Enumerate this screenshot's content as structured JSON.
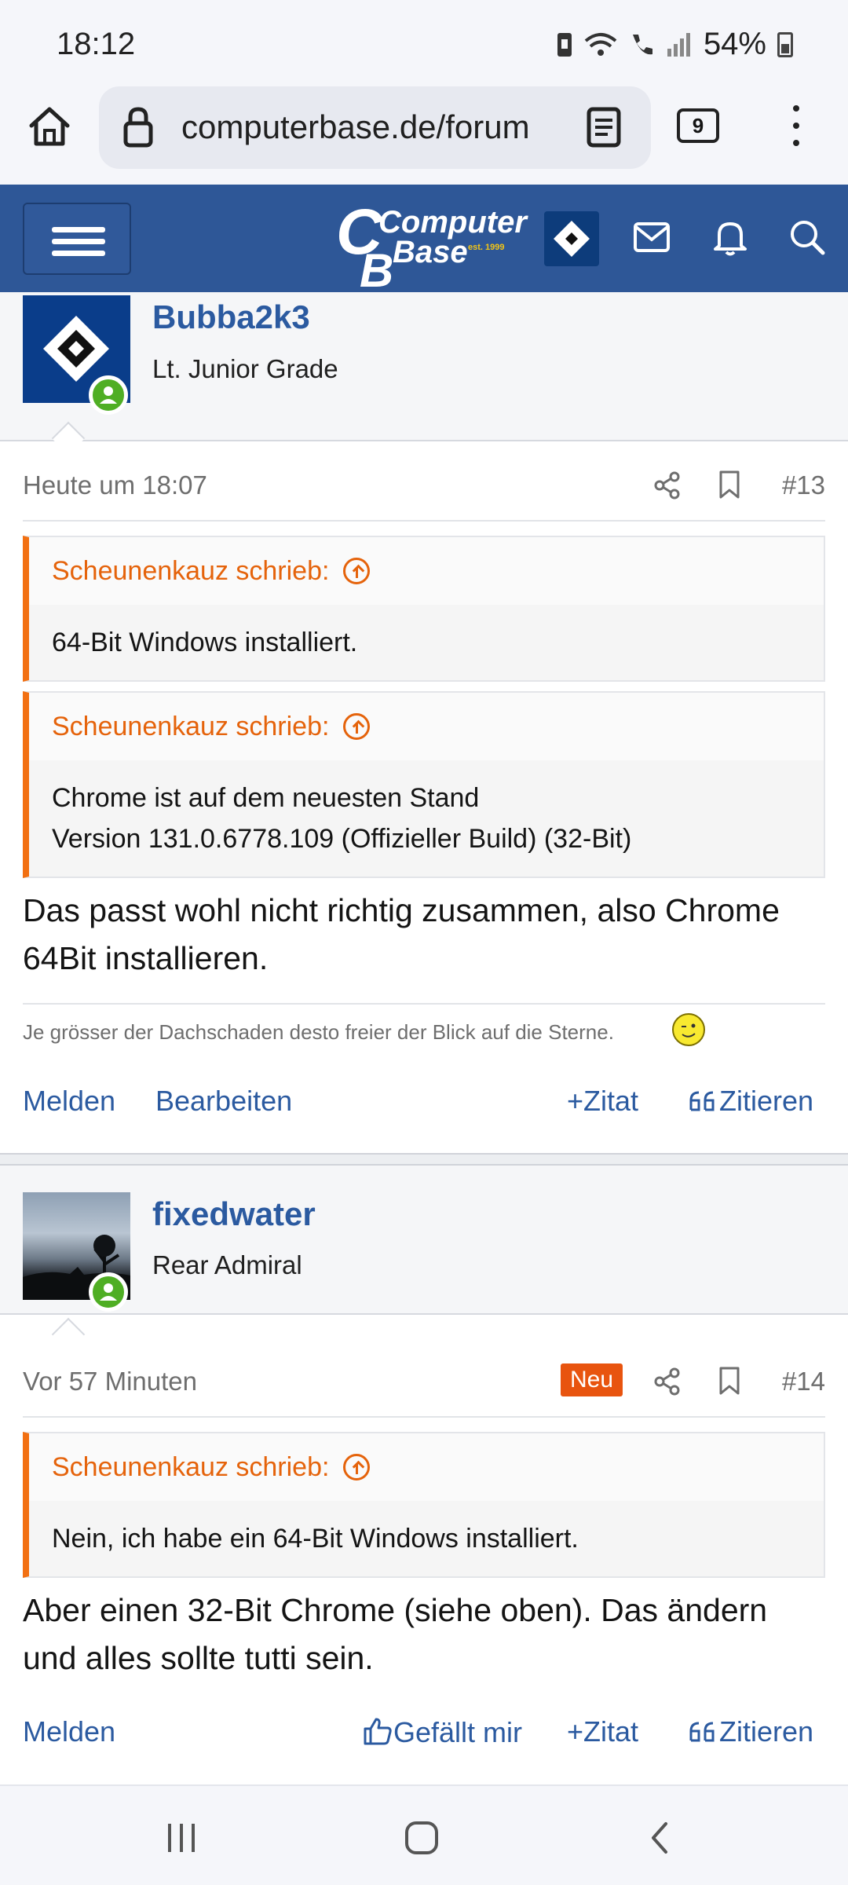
{
  "status_bar": {
    "time": "18:12",
    "battery": "54%"
  },
  "browser": {
    "url": "computerbase.de/forum",
    "tab_count": "9"
  },
  "site": {
    "logo_line1": "Computer",
    "logo_line2": "Base",
    "logo_tag": "est. 1999"
  },
  "posts": [
    {
      "author": "Bubba2k3",
      "rank": "Lt. Junior Grade",
      "time": "Heute um 18:07",
      "number": "#13",
      "quotes": [
        {
          "author": "Scheunenkauz schrieb:",
          "lines": [
            "64-Bit Windows installiert."
          ]
        },
        {
          "author": "Scheunenkauz schrieb:",
          "lines": [
            "Chrome ist auf dem neuesten Stand",
            "Version 131.0.6778.109 (Offizieller Build) (32-Bit)"
          ]
        }
      ],
      "body_lines": [
        "Das passt wohl nicht richtig zusammen, also Chrome",
        "64Bit installieren."
      ],
      "signature": "Je grösser der Dachschaden desto freier der Blick auf die Sterne.",
      "actions": {
        "report": "Melden",
        "edit": "Bearbeiten",
        "add_quote": "Zitat",
        "reply_quote": "Zitieren"
      }
    },
    {
      "author": "fixedwater",
      "rank": "Rear Admiral",
      "time": "Vor 57 Minuten",
      "badge": "Neu",
      "number": "#14",
      "quotes": [
        {
          "author": "Scheunenkauz schrieb:",
          "lines": [
            "Nein, ich habe ein 64-Bit Windows installiert."
          ]
        }
      ],
      "body_lines": [
        "Aber einen 32-Bit Chrome (siehe oben). Das ändern",
        "und alles sollte tutti sein."
      ],
      "actions": {
        "report": "Melden",
        "like": "Gefällt mir",
        "add_quote": "Zitat",
        "reply_quote": "Zitieren"
      }
    }
  ],
  "colors": {
    "brand_blue": "#2e5797",
    "link_blue": "#2b5aa0",
    "quote_orange": "#e5630b",
    "online_green": "#4fae24"
  }
}
